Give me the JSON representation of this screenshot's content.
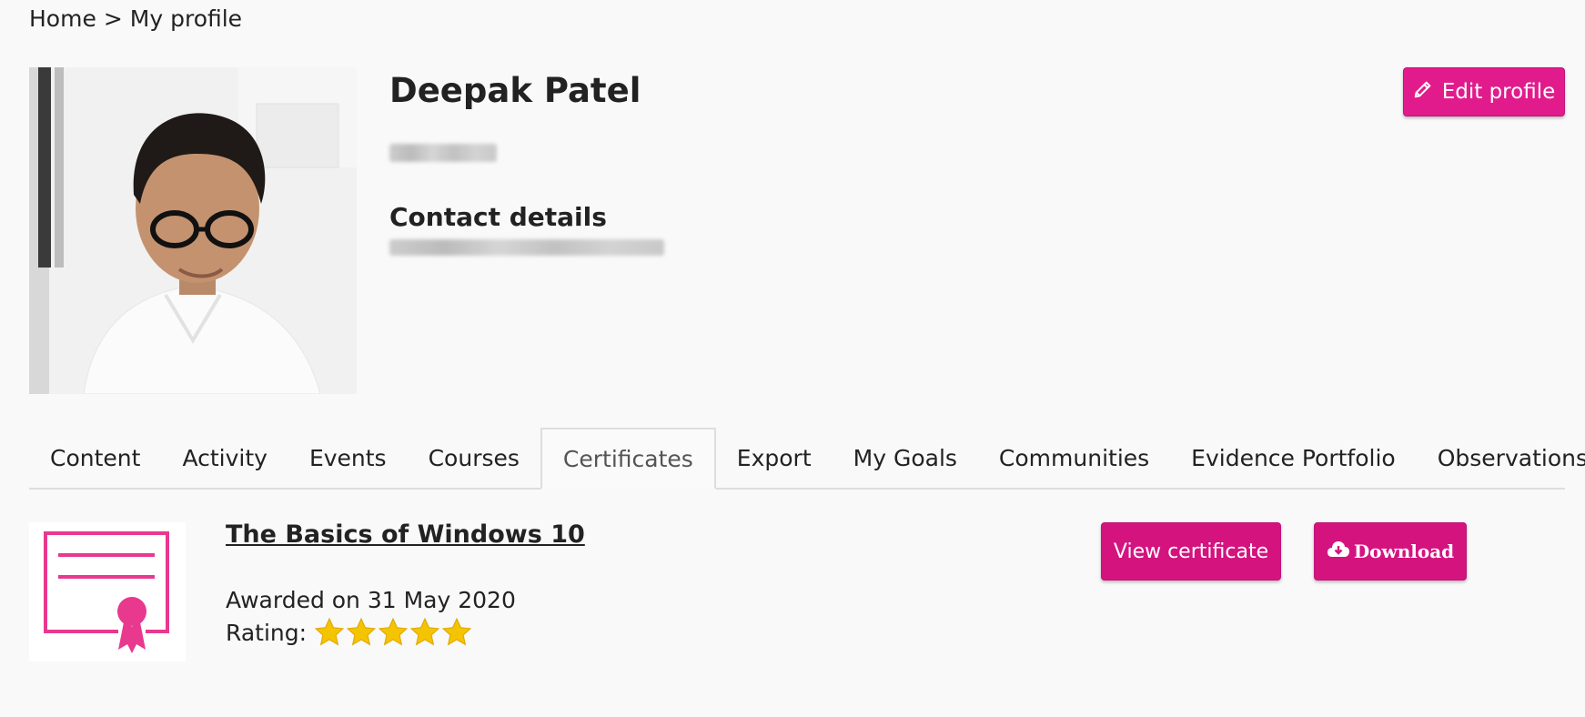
{
  "breadcrumb": {
    "home": "Home",
    "separator": ">",
    "current": "My profile"
  },
  "profile": {
    "name": "Deepak Patel",
    "contact_heading": "Contact details"
  },
  "header": {
    "edit_label": "Edit profile"
  },
  "tabs": [
    {
      "label": "Content"
    },
    {
      "label": "Activity"
    },
    {
      "label": "Events"
    },
    {
      "label": "Courses"
    },
    {
      "label": "Certificates",
      "active": true
    },
    {
      "label": "Export"
    },
    {
      "label": "My Goals"
    },
    {
      "label": "Communities"
    },
    {
      "label": "Evidence Portfolio"
    },
    {
      "label": "Observations"
    }
  ],
  "certificate": {
    "title": "The Basics of Windows 10",
    "awarded": "Awarded on 31 May 2020",
    "rating_label": "Rating:",
    "rating": 5,
    "rating_max": 5,
    "view_label": "View certificate",
    "download_label": "Download"
  },
  "colors": {
    "accent": "#e21b8c",
    "star": "#f5c400",
    "certificate_icon": "#e8398f"
  },
  "icons": {
    "edit": "pencil-icon",
    "download": "cloud-download-icon",
    "certificate": "certificate-icon",
    "star": "star-icon"
  }
}
